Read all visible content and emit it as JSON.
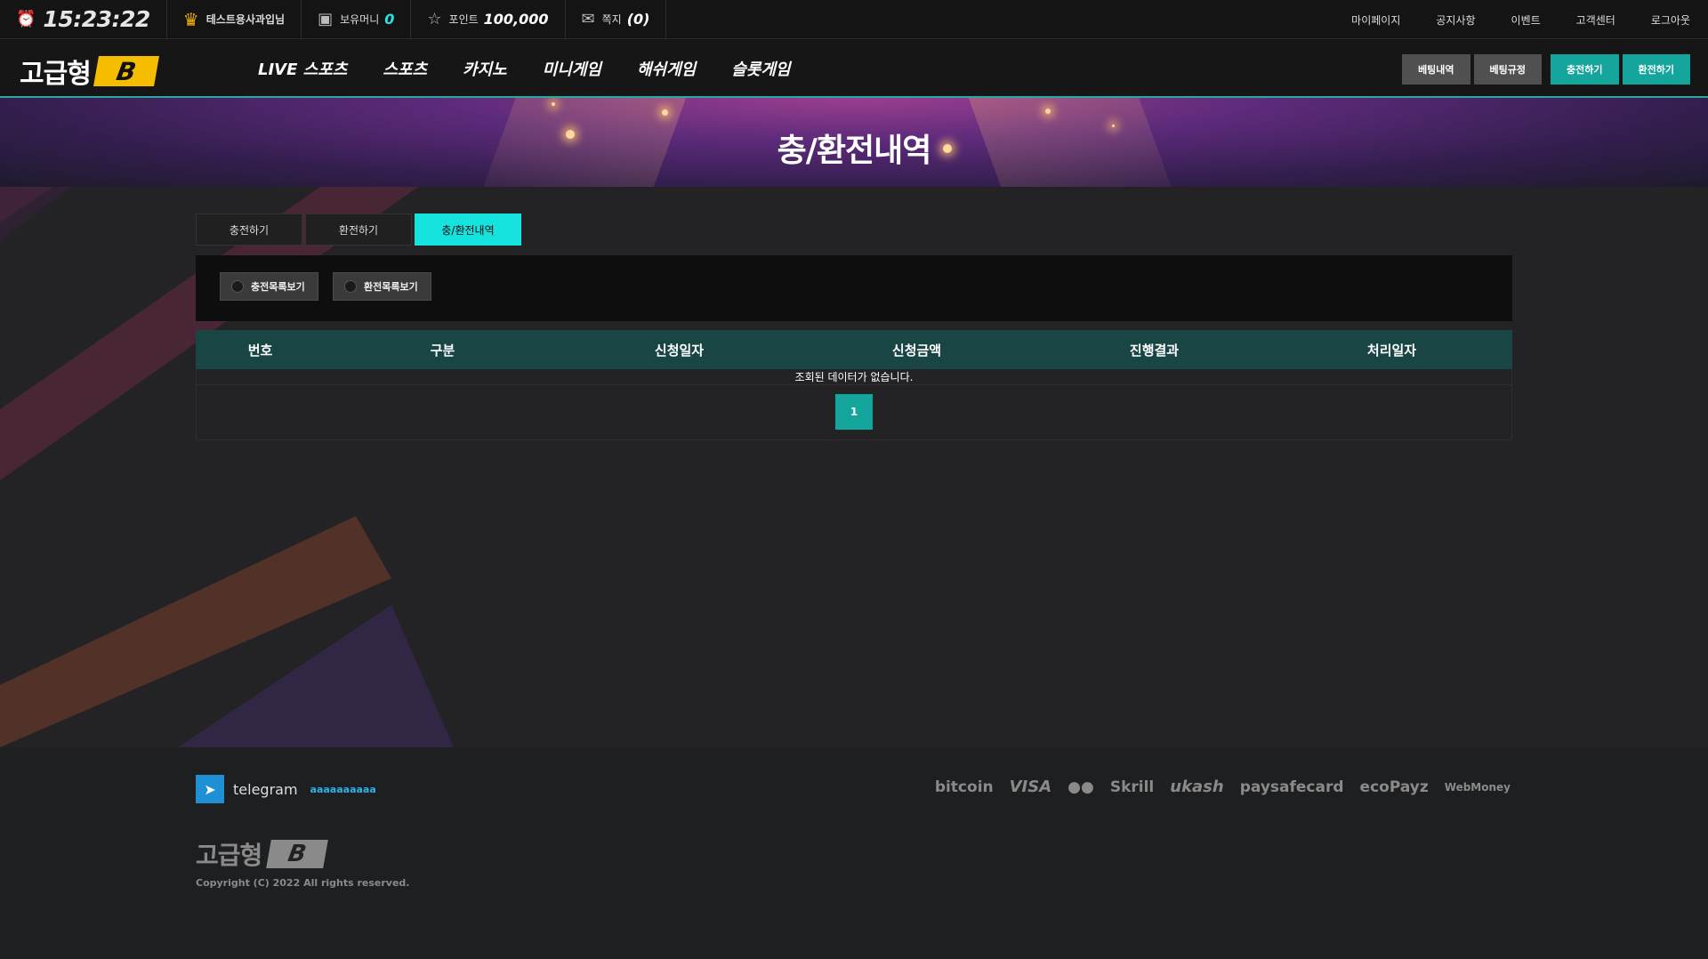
{
  "topbar": {
    "clock": "15:23:22",
    "user": "테스트용사과입님",
    "money_label": "보유머니",
    "money_value": "0",
    "point_label": "포인트",
    "point_value": "100,000",
    "message_label": "쪽지",
    "message_value": "(0)",
    "links": [
      "마이페이지",
      "공지사항",
      "이벤트",
      "고객센터",
      "로그아웃"
    ]
  },
  "nav": {
    "logo_text": "고급형",
    "logo_badge": "B",
    "menu": [
      "LIVE 스포츠",
      "스포츠",
      "카지노",
      "미니게임",
      "해쉬게임",
      "슬롯게임"
    ],
    "buttons": [
      "베팅내역",
      "베팅규정",
      "충전하기",
      "환전하기"
    ]
  },
  "banner": {
    "title": "충/환전내역"
  },
  "tabs": [
    "충전하기",
    "환전하기",
    "충/환전내역"
  ],
  "filters": [
    "충전목록보기",
    "환전목록보기"
  ],
  "table": {
    "columns": [
      "번호",
      "구분",
      "신청일자",
      "신청금액",
      "진행결과",
      "처리일자"
    ],
    "empty_message": "조회된 데이터가 없습니다.",
    "page": "1"
  },
  "footer": {
    "telegram_label": "telegram",
    "telegram_id": "aaaaaaaaaa",
    "payments": [
      "bitcoin",
      "VISA",
      "●●",
      "Skrill",
      "ukash",
      "paysafecard",
      "ecoPayz",
      "WebMoney"
    ],
    "logo_text": "고급형",
    "logo_badge": "B",
    "copyright": "Copyright (C) 2022 All rights reserved."
  },
  "colors": {
    "accent_cyan": "#16e2de",
    "teal_button": "#14a59c",
    "logo_yellow": "#f6bd00",
    "table_header": "#1a4545"
  }
}
